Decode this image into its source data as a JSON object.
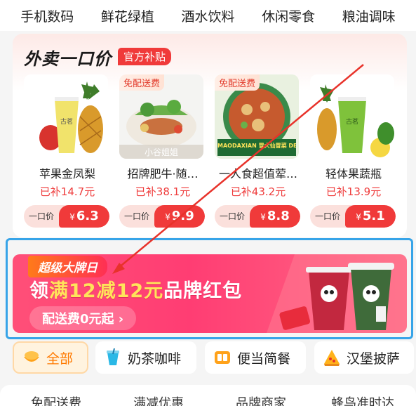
{
  "top_categories": [
    "手机数码",
    "鲜花绿植",
    "酒水饮料",
    "休闲零食",
    "粮油调味"
  ],
  "takeout": {
    "title": "外卖一口价",
    "badge": "官方补贴",
    "price_label": "一口价",
    "currency": "¥",
    "products": [
      {
        "name": "苹果金凤梨",
        "subsidy": "已补14.7元",
        "price": "6.3",
        "free_delivery": ""
      },
      {
        "name": "招牌肥牛·随…",
        "subsidy": "已补38.1元",
        "price": "9.9",
        "free_delivery": "免配送费",
        "store": "小谷姐姐"
      },
      {
        "name": "一人食超值荤…",
        "subsidy": "已补43.2元",
        "price": "8.8",
        "free_delivery": "免配送费",
        "store": "MAODAXIAN 冒大仙冒菜 DELICIOUS"
      },
      {
        "name": "轻体果蔬瓶",
        "subsidy": "已补13.9元",
        "price": "5.1",
        "free_delivery": ""
      }
    ]
  },
  "banner": {
    "pill": "超级大牌日",
    "main_prefix": "领",
    "main_highlight": "满12减12元",
    "main_suffix": "品牌红包",
    "button": "配送费0元起 ›"
  },
  "chips": [
    {
      "label": "全部",
      "active": true,
      "icon": "bowl-icon"
    },
    {
      "label": "奶茶咖啡",
      "active": false,
      "icon": "drink-icon"
    },
    {
      "label": "便当简餐",
      "active": false,
      "icon": "bento-icon"
    },
    {
      "label": "汉堡披萨",
      "active": false,
      "icon": "pizza-icon"
    }
  ],
  "bottom_tabs": [
    "免配送费",
    "满减优惠",
    "品牌商家",
    "蜂鸟准时达"
  ],
  "colors": {
    "accent": "#f03a3a",
    "banner": "#ff3d73",
    "frame": "#37a4e8",
    "arrow": "#e8322a"
  }
}
